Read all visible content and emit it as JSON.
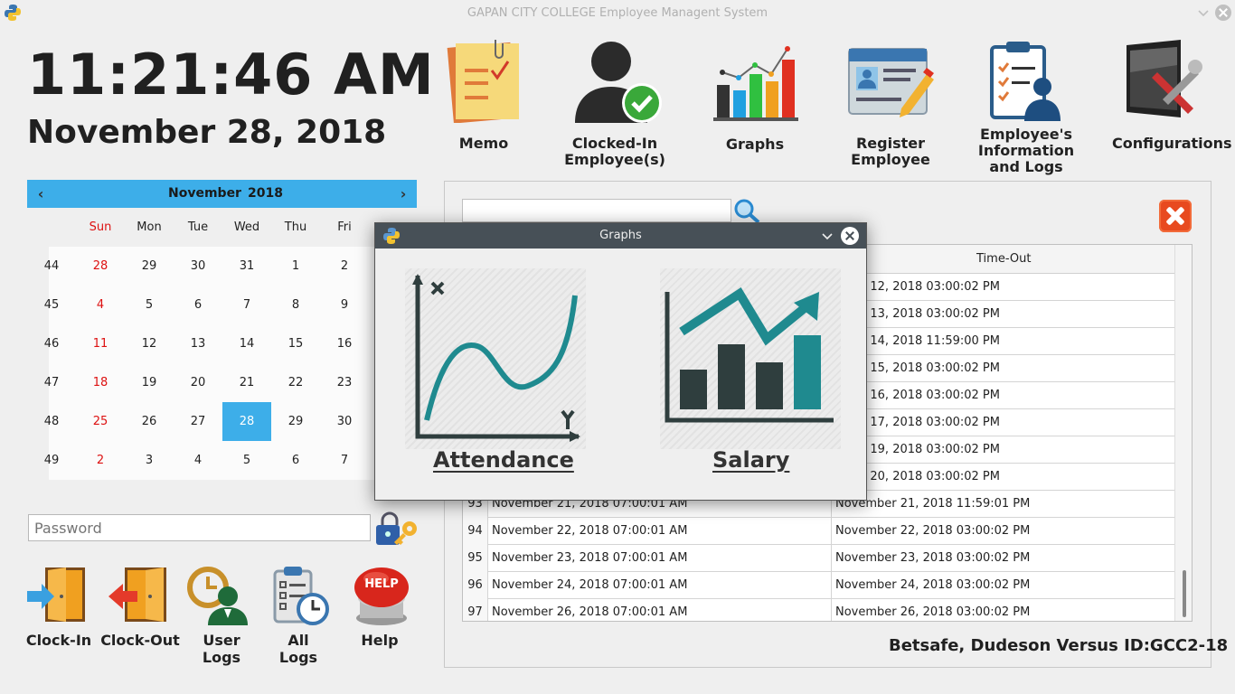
{
  "window": {
    "title": "GAPAN CITY COLLEGE Employee Managent System"
  },
  "clock": {
    "time": "11:21:46 AM",
    "date": "November 28, 2018"
  },
  "calendar": {
    "month": "November",
    "year": "2018",
    "dow": [
      "Sun",
      "Mon",
      "Tue",
      "Wed",
      "Thu",
      "Fri"
    ],
    "weeks": [
      {
        "num": "44",
        "days": [
          "28",
          "29",
          "30",
          "31",
          "1",
          "2"
        ]
      },
      {
        "num": "45",
        "days": [
          "4",
          "5",
          "6",
          "7",
          "8",
          "9"
        ]
      },
      {
        "num": "46",
        "days": [
          "11",
          "12",
          "13",
          "14",
          "15",
          "16"
        ]
      },
      {
        "num": "47",
        "days": [
          "18",
          "19",
          "20",
          "21",
          "22",
          "23"
        ]
      },
      {
        "num": "48",
        "days": [
          "25",
          "26",
          "27",
          "28",
          "29",
          "30"
        ]
      },
      {
        "num": "49",
        "days": [
          "2",
          "3",
          "4",
          "5",
          "6",
          "7"
        ]
      }
    ],
    "selected": "28"
  },
  "password": {
    "placeholder": "Password"
  },
  "toolbar": [
    {
      "label": "Memo",
      "icon": "memo-icon"
    },
    {
      "label": "Clocked-In\nEmployee(s)",
      "icon": "clocked-in-icon"
    },
    {
      "label": "Graphs",
      "icon": "graphs-icon"
    },
    {
      "label": "Register\nEmployee",
      "icon": "register-icon"
    },
    {
      "label": "Employee's\nInformation\nand Logs",
      "icon": "employee-info-icon"
    },
    {
      "label": "Configurations",
      "icon": "configurations-icon"
    }
  ],
  "bottom_buttons": [
    {
      "label": "Clock-In",
      "icon": "clock-in-door-icon"
    },
    {
      "label": "Clock-Out",
      "icon": "clock-out-door-icon"
    },
    {
      "label": "User\nLogs",
      "icon": "user-logs-icon"
    },
    {
      "label": "All\nLogs",
      "icon": "all-logs-icon"
    },
    {
      "label": "Help",
      "icon": "help-button-icon"
    }
  ],
  "table": {
    "header_timeout": "Time-Out",
    "rows": [
      {
        "n": "",
        "in": "",
        "out": "mber 12, 2018 03:00:02 PM"
      },
      {
        "n": "",
        "in": "",
        "out": "mber 13, 2018 03:00:02 PM"
      },
      {
        "n": "",
        "in": "",
        "out": "mber 14, 2018 11:59:00 PM"
      },
      {
        "n": "",
        "in": "",
        "out": "mber 15, 2018 03:00:02 PM"
      },
      {
        "n": "",
        "in": "",
        "out": "mber 16, 2018 03:00:02 PM"
      },
      {
        "n": "",
        "in": "",
        "out": "mber 17, 2018 03:00:02 PM"
      },
      {
        "n": "",
        "in": "",
        "out": "mber 19, 2018 03:00:02 PM"
      },
      {
        "n": "",
        "in": "",
        "out": "mber 20, 2018 03:00:02 PM"
      },
      {
        "n": "93",
        "in": "November 21, 2018 07:00:01 AM",
        "out": "November 21, 2018 11:59:01 PM"
      },
      {
        "n": "94",
        "in": "November 22, 2018 07:00:01 AM",
        "out": "November 22, 2018 03:00:02 PM"
      },
      {
        "n": "95",
        "in": "November 23, 2018 07:00:01 AM",
        "out": "November 23, 2018 03:00:02 PM"
      },
      {
        "n": "96",
        "in": "November 24, 2018 07:00:01 AM",
        "out": "November 24, 2018 03:00:02 PM"
      },
      {
        "n": "97",
        "in": "November 26, 2018 07:00:01 AM",
        "out": "November 26, 2018 03:00:02 PM"
      }
    ]
  },
  "footer": {
    "user": "Betsafe, Dudeson Versus  ID:GCC2-18"
  },
  "dialog": {
    "title": "Graphs",
    "attendance_label": "Attendance",
    "salary_label": "Salary"
  },
  "colors": {
    "accent": "#3daee9",
    "dialog_titlebar": "#475057",
    "chart_teal": "#1f8a8f",
    "chart_dark": "#2f3e3e"
  }
}
